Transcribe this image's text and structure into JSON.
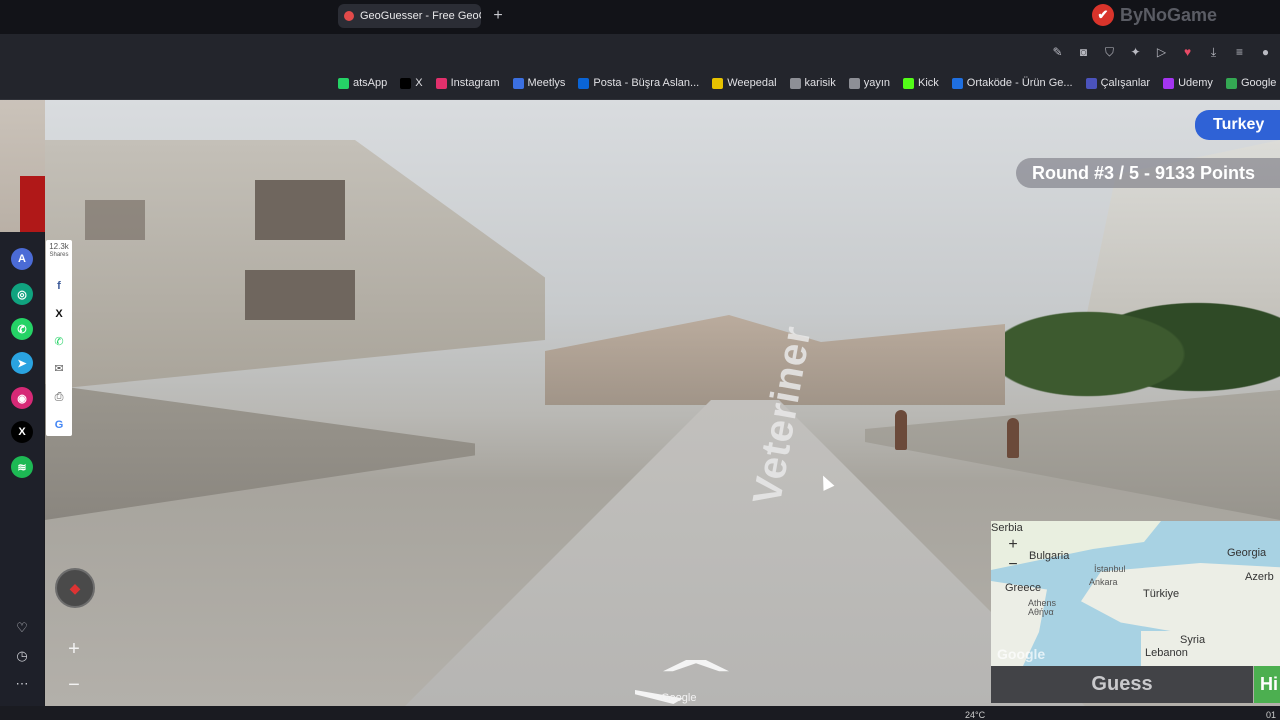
{
  "browser": {
    "active_tab_title": "GeoGuesser - Free GeoG",
    "new_tab_icon": "plus",
    "vpn_watermark": "ByNoGame",
    "toolbar_icons": [
      "edit-icon",
      "camera-icon",
      "shield-icon",
      "extension-icon",
      "play-icon",
      "heart-icon",
      "download-icon",
      "menu-icon",
      "profile-icon"
    ]
  },
  "bookmarks": [
    {
      "label": "atsApp",
      "icon": "whatsapp-icon",
      "color": "#25d366"
    },
    {
      "label": "X",
      "icon": "x-icon",
      "color": "#000000"
    },
    {
      "label": "Instagram",
      "icon": "instagram-icon",
      "color": "#e1306c"
    },
    {
      "label": "Meetlys",
      "icon": "meetlys-icon",
      "color": "#3b6fe0"
    },
    {
      "label": "Posta - Büşra Aslan...",
      "icon": "outlook-icon",
      "color": "#0a64d6"
    },
    {
      "label": "Weepedal",
      "icon": "weepedal-icon",
      "color": "#e7c200"
    },
    {
      "label": "karisik",
      "icon": "folder-icon",
      "color": "#8d8f96"
    },
    {
      "label": "yayın",
      "icon": "folder-icon",
      "color": "#8d8f96"
    },
    {
      "label": "Kick",
      "icon": "kick-icon",
      "color": "#53fc18"
    },
    {
      "label": "Ortaköde - Ürün Ge...",
      "icon": "trello-icon",
      "color": "#1f6fe0"
    },
    {
      "label": "Çalışanlar",
      "icon": "teams-icon",
      "color": "#4b53bc"
    },
    {
      "label": "Udemy",
      "icon": "udemy-icon",
      "color": "#a435f0"
    },
    {
      "label": "Google Haritalar",
      "icon": "maps-icon",
      "color": "#34a853"
    }
  ],
  "game": {
    "round_text": "Round #3 / 5 - 9133 Points",
    "country_pill": "Turkey",
    "street_name": "Veteriner",
    "google_watermark": "Google",
    "guess_label": "Guess",
    "hide_label": "Hi"
  },
  "minimap": {
    "labels": {
      "serbia": "Serbia",
      "bulgaria": "Bulgaria",
      "georgia": "Georgia",
      "istanbul": "İstanbul",
      "ankara": "Ankara",
      "azerbaijan": "Azerb",
      "greece": "Greece",
      "turkiye": "Türkiye",
      "athens": "Athens",
      "athina": "Αθήνα",
      "syria": "Syria",
      "lebanon": "Lebanon"
    },
    "google_logo": "Google",
    "zoom_in": "+",
    "zoom_out": "−"
  },
  "sv_zoom": {
    "in": "+",
    "out": "−"
  },
  "share": {
    "count": "12.3k",
    "count_label": "Shares"
  },
  "dock_icons": [
    "arc-icon",
    "chatgpt-icon",
    "whatsapp-icon",
    "telegram-icon",
    "instagram-icon",
    "x-icon",
    "spotify-icon",
    "heart-icon",
    "clock-icon",
    "more-icon"
  ],
  "taskbar": {
    "weather": "24°C",
    "time": "01"
  }
}
